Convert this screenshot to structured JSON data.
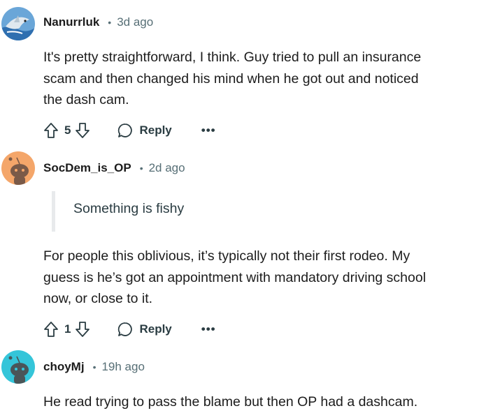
{
  "comments": [
    {
      "author": "Nanurrluk",
      "separator": "•",
      "time": "3d ago",
      "avatar": "shark-avatar-icon",
      "quote": null,
      "lines": [
        "It's pretty straightforward, I think. Guy tried to pull an insurance",
        "scam and then changed his mind when he got out and noticed",
        "the dash cam."
      ],
      "votes": "5",
      "reply_label": "Reply",
      "more_label": "•••"
    },
    {
      "author": "SocDem_is_OP",
      "separator": "•",
      "time": "2d ago",
      "avatar": "snoo-orange-avatar-icon",
      "quote": "Something is fishy",
      "lines": [
        "For people this oblivious, it’s typically not their first rodeo. My",
        "guess is he’s got an appointment with mandatory driving school",
        "now, or close to it."
      ],
      "votes": "1",
      "reply_label": "Reply",
      "more_label": "•••"
    },
    {
      "author": "choyMj",
      "separator": "•",
      "time": "19h ago",
      "avatar": "snoo-teal-avatar-icon",
      "quote": null,
      "lines": [
        "He read trying to pass the blame but then OP had a dashcam."
      ]
    }
  ],
  "colors": {
    "meta_gray": "#576f76",
    "text": "#1c1c1c",
    "quote_bar": "#e8eaec",
    "orange_avatar": "#f4a66a",
    "teal_avatar": "#35c5d9"
  }
}
